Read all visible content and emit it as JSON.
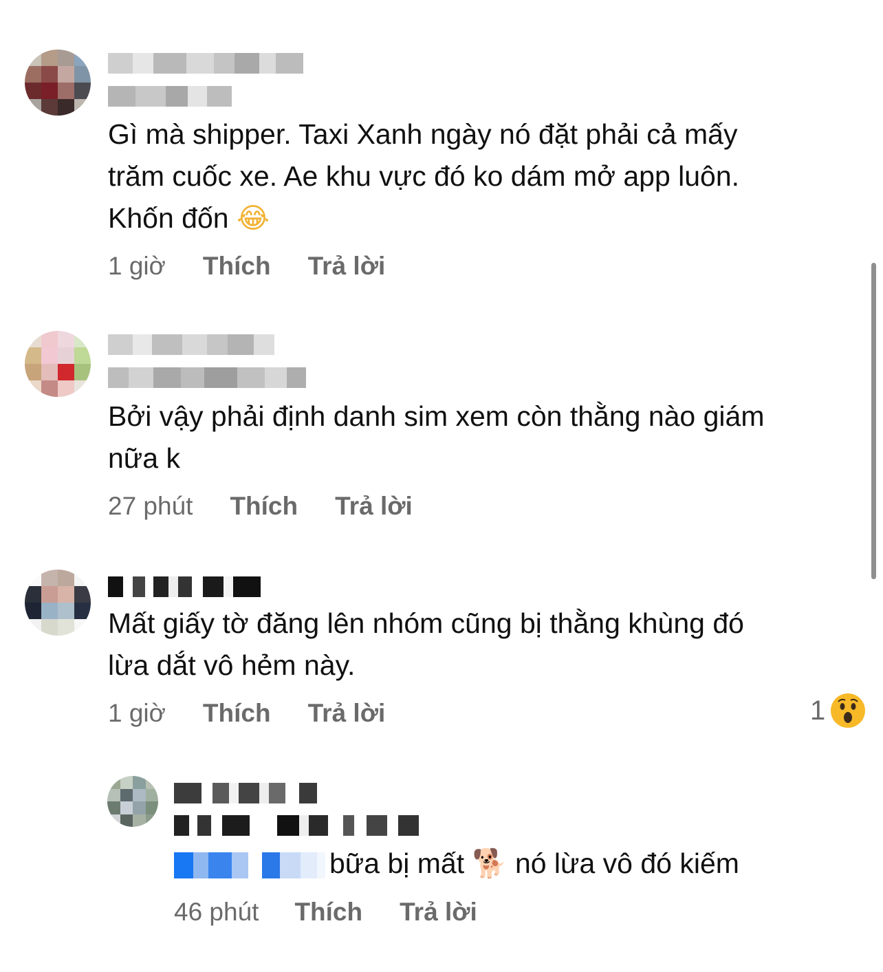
{
  "comments": [
    {
      "text": "Gì mà shipper. Taxi Xanh ngày nó đặt phải cả mấy\ntrăm cuốc xe. Ae khu vực đó ko dám mở app luôn.\nKhốn đốn ",
      "emoji": "😂",
      "time": "1 giờ",
      "like": "Thích",
      "reply": "Trả lời"
    },
    {
      "text": "Bởi vậy phải định danh sim xem còn thằng nào giám\nnữa k",
      "time": "27 phút",
      "like": "Thích",
      "reply": "Trả lời"
    },
    {
      "text": "Mất giấy tờ đăng lên nhóm cũng bị thằng khùng đó\nlừa dắt vô hẻm này.",
      "time": "1 giờ",
      "like": "Thích",
      "reply": "Trả lời",
      "reaction_count": "1",
      "reaction_icon": "wow-face-icon"
    },
    {
      "text_before": "bữa bị mất ",
      "emoji": "🐕",
      "text_after": " nó lừa vô đó kiếm",
      "time": "46 phút",
      "like": "Thích",
      "reply": "Trả lời"
    }
  ],
  "colors": {
    "meta": "#6a6a6a",
    "text": "#101010",
    "reaction": "#f7b928",
    "mention": "#1877f2"
  }
}
